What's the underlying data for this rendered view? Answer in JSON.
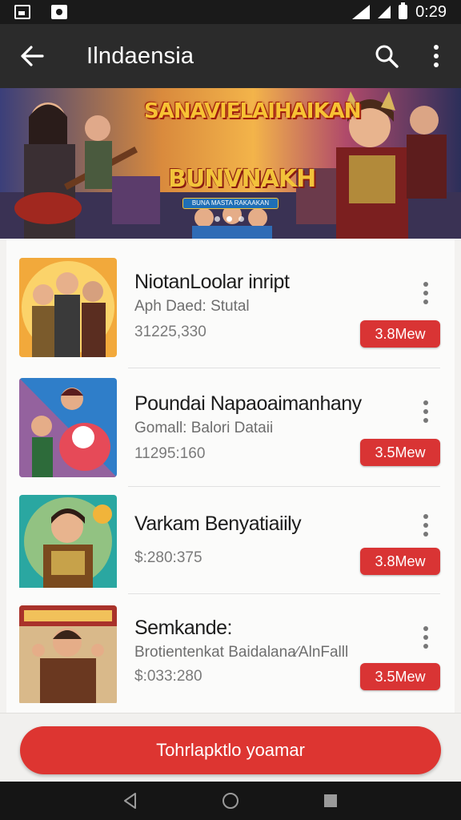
{
  "status_bar": {
    "time": "0:29"
  },
  "app_bar": {
    "title": "Ilndaensia",
    "back_icon": "arrow-left-icon",
    "search_icon": "search-icon",
    "menu_icon": "more-vert-icon"
  },
  "banner": {
    "title": "SANAVIELAIHAIKAN",
    "logo": "BUNVNAKH",
    "tag": "BUNA MASTA RAKAAKAN",
    "dots": 3,
    "active_dot": 1
  },
  "items": [
    {
      "name": "NiotanLoolar inript",
      "sub": "Aph Daed: Stutal",
      "stat": "31225,330",
      "price": "3.8Mew"
    },
    {
      "name": "Poundai Napaoaimanhany",
      "sub": "Gomall: Balori Dataii",
      "stat": "11295:160",
      "price": "3.5Mew"
    },
    {
      "name": "Varkam Benyatiaiily",
      "sub": "",
      "stat": "$:280:375",
      "price": "3.8Mew"
    },
    {
      "name": "Semkande:",
      "sub": "Brotientenkat Baidalana∕AlnFalll",
      "stat": "$:033:280",
      "price": "3.5Mew"
    }
  ],
  "cta": {
    "label": "Tohrlapktlo yoamar"
  },
  "colors": {
    "accent": "#dd3531",
    "appbar": "#2b2b2b",
    "statusbar": "#1a1a1a"
  }
}
